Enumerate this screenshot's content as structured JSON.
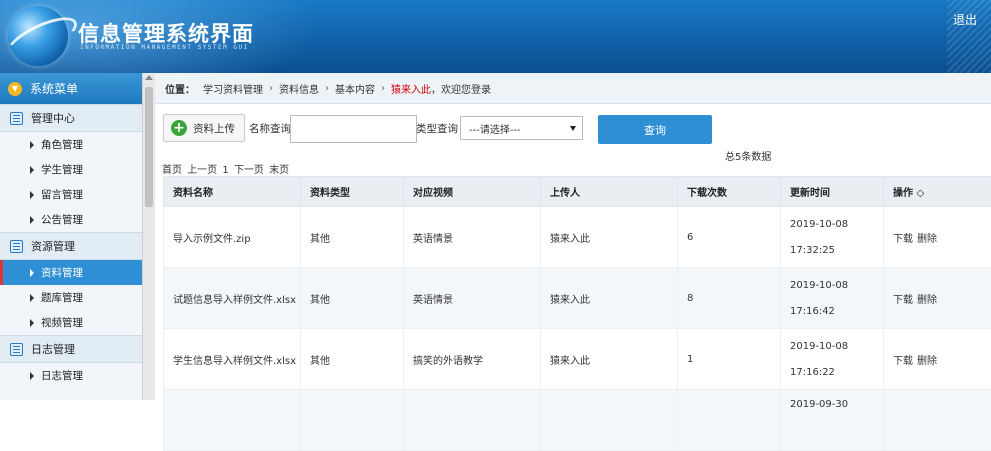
{
  "header": {
    "title": "信息管理系统界面",
    "subtitle": "INFORMATION MANAGEMENT SYSTEM GUI",
    "logout_label": "退出"
  },
  "sidebar": {
    "title": "系统菜单",
    "groups": [
      {
        "label": "管理中心",
        "items": [
          "角色管理",
          "学生管理",
          "留言管理",
          "公告管理"
        ]
      },
      {
        "label": "资源管理",
        "items": [
          "资料管理",
          "题库管理",
          "视频管理"
        ]
      },
      {
        "label": "日志管理",
        "items": [
          "日志管理"
        ]
      }
    ]
  },
  "breadcrumb": {
    "prefix": "位置：",
    "items": [
      "学习资料管理",
      "资料信息",
      "基本内容"
    ],
    "user": "猿来入此",
    "welcome": "，欢迎您登录"
  },
  "toolbar": {
    "upload_label": "资料上传",
    "name_query_label": "名称查询",
    "name_query_value": "",
    "type_query_label": "类型查询",
    "type_select_value": "---请选择---",
    "query_label": "查询",
    "total_text": "总5条数据"
  },
  "pager": {
    "first": "首页",
    "prev": "上一页",
    "page": "1",
    "next": "下一页",
    "last": "末页"
  },
  "table": {
    "columns": [
      "资料名称",
      "资料类型",
      "对应视频",
      "上传人",
      "下载次数",
      "更新时间",
      "操作 ◇"
    ],
    "rows": [
      {
        "name": "导入示例文件.zip",
        "type": "其他",
        "video": "英语情景",
        "uploader": "猿来入此",
        "downloads": "6",
        "date": "2019-10-08",
        "time": "17:32:25",
        "op1": "下载",
        "op2": "删除"
      },
      {
        "name": "试题信息导入样例文件.xlsx",
        "type": "其他",
        "video": "英语情景",
        "uploader": "猿来入此",
        "downloads": "8",
        "date": "2019-10-08",
        "time": "17:16:42",
        "op1": "下载",
        "op2": "删除"
      },
      {
        "name": "学生信息导入样例文件.xlsx",
        "type": "其他",
        "video": "搞笑的外语教学",
        "uploader": "猿来入此",
        "downloads": "1",
        "date": "2019-10-08",
        "time": "17:16:22",
        "op1": "下载",
        "op2": "删除"
      },
      {
        "name": "",
        "type": "",
        "video": "",
        "uploader": "",
        "downloads": "",
        "date": "2019-09-30",
        "time": "",
        "op1": "",
        "op2": ""
      }
    ]
  },
  "colors": {
    "accent": "#2f8fd5",
    "header": "#0f5fa6",
    "user_highlight": "#cc0000",
    "add_icon": "#3aa33a"
  }
}
